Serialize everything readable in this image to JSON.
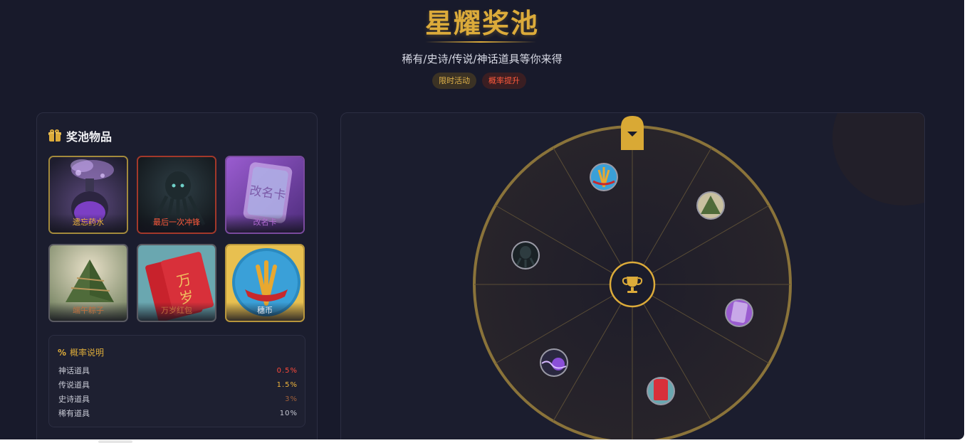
{
  "header": {
    "title": "星耀奖池",
    "subtitle": "稀有/史诗/传说/神话道具等你来得",
    "tags": [
      {
        "label": "限时活动",
        "color": "#e0b24a"
      },
      {
        "label": "概率提升",
        "color": "#ff5a3c"
      }
    ]
  },
  "pool": {
    "title": "奖池物品",
    "icon": "gift-icon",
    "items": [
      {
        "label": "遗忘药水",
        "label_color": "#f0b53c",
        "icon": "potion-icon",
        "border": "#a38a3c"
      },
      {
        "label": "最后一次冲锋",
        "label_color": "#ff5a3c",
        "icon": "octopus-icon",
        "border": "#a3382a"
      },
      {
        "label": "改名卡",
        "label_color": "#b06ad0",
        "icon": "rename-card-icon",
        "border": "#7a4a9e"
      },
      {
        "label": "端午粽子",
        "label_color": "#c07040",
        "icon": "zongzi-icon",
        "border": "#6a6a70"
      },
      {
        "label": "万岁红包",
        "label_color": "#c07040",
        "icon": "red-envelope-icon",
        "border": "#6a6a70"
      },
      {
        "label": "穗币",
        "label_color": "#e8e8ee",
        "icon": "wheat-coin-icon",
        "border": "#6a6a70"
      }
    ]
  },
  "probability": {
    "title": "概率说明",
    "icon": "percent-icon",
    "rows": [
      {
        "name": "神话道具",
        "value": "0.5%",
        "color": "#ff4a3a"
      },
      {
        "name": "传说道具",
        "value": "1.5%",
        "color": "#f0b53c"
      },
      {
        "name": "史诗道具",
        "value": "3%",
        "color": "#a0603a"
      },
      {
        "name": "稀有道具",
        "value": "10%",
        "color": "#c7c9d4"
      }
    ]
  },
  "wheel": {
    "segments": 8,
    "center_icon": "trophy-icon",
    "pointer_icon": "caret-down-icon",
    "accent": "#dcab3a",
    "tokens": [
      {
        "icon": "wheat-coin-icon"
      },
      {
        "icon": "zongzi-icon"
      },
      {
        "icon": "rename-card-icon"
      },
      {
        "icon": "red-envelope-icon"
      },
      {
        "icon": "potion-icon"
      },
      {
        "icon": "octopus-icon"
      }
    ]
  }
}
